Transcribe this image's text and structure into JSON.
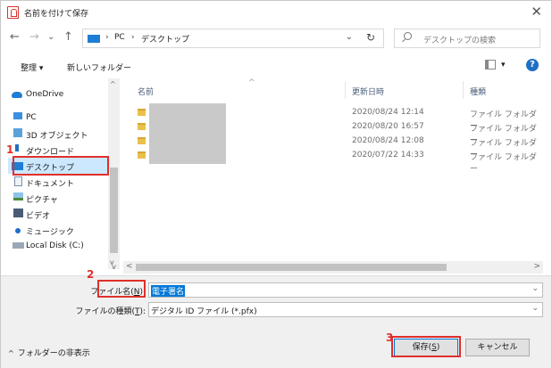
{
  "window": {
    "title": "名前を付けて保存",
    "close": "✕"
  },
  "nav": {
    "back": "←",
    "forward": "→",
    "recent": "⌄",
    "up": "↑"
  },
  "address": {
    "sep1": "›",
    "crumb1": "PC",
    "sep2": "›",
    "crumb2": "デスクトップ",
    "dropdown": "⌄",
    "refresh": "↻"
  },
  "search": {
    "placeholder": "デスクトップの検索"
  },
  "toolbar": {
    "organize": "整理 ▾",
    "new_folder": "新しいフォルダー",
    "view_arrow": "▾",
    "help": "?"
  },
  "sidebar": {
    "items": [
      {
        "label": "OneDrive",
        "icon": "cloud-icon"
      },
      {
        "label": "PC",
        "icon": "computer-icon"
      },
      {
        "label": "3D オブジェクト",
        "icon": "cube-icon"
      },
      {
        "label": "ダウンロード",
        "icon": "download-icon"
      },
      {
        "label": "デスクトップ",
        "icon": "desktop-icon"
      },
      {
        "label": "ドキュメント",
        "icon": "document-icon"
      },
      {
        "label": "ピクチャ",
        "icon": "picture-icon"
      },
      {
        "label": "ビデオ",
        "icon": "video-icon"
      },
      {
        "label": "ミュージック",
        "icon": "music-icon"
      },
      {
        "label": "Local Disk (C:)",
        "icon": "disk-icon"
      }
    ],
    "scroll_up": "^",
    "scroll_down": "v"
  },
  "filelist": {
    "columns": {
      "name": "名前",
      "sort": "^",
      "modified": "更新日時",
      "type": "種類"
    },
    "rows": [
      {
        "date": "2020/08/24 12:14",
        "type": "ファイル フォルダー"
      },
      {
        "date": "2020/08/20 16:57",
        "type": "ファイル フォルダー"
      },
      {
        "date": "2020/08/24 12:08",
        "type": "ファイル フォルダー"
      },
      {
        "date": "2020/07/22 14:33",
        "type": "ファイル フォルダー"
      }
    ],
    "hscroll_left": "<",
    "hscroll_right": ">",
    "corner": "v"
  },
  "form": {
    "filename_label_pre": "ファイル名(",
    "filename_label_key": "N",
    "filename_label_post": "):",
    "filename_value": "電子署名",
    "filetype_label_pre": "ファイルの種類(",
    "filetype_label_key": "T",
    "filetype_label_post": "):",
    "filetype_value": "デジタル ID ファイル (*.pfx)",
    "arrow": "⌄"
  },
  "footer": {
    "hide_folders": "フォルダーの非表示",
    "caret": "^",
    "save_pre": "保存(",
    "save_key": "S",
    "save_post": ")",
    "cancel": "キャンセル"
  },
  "annotations": {
    "step1": "1",
    "step2": "2",
    "step3": "3"
  },
  "colors": {
    "accent": "#0078d7",
    "annotation": "#e0302b",
    "selected": "#cce8ff"
  }
}
